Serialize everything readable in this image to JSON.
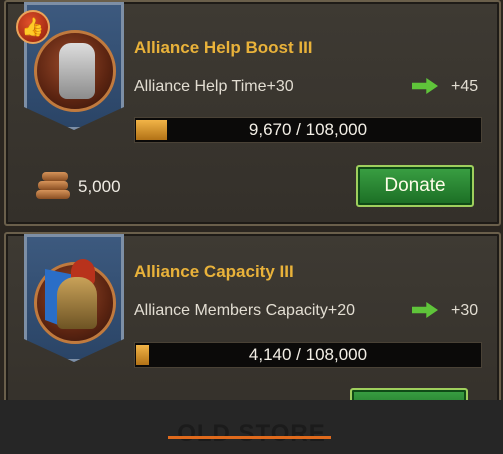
{
  "cards": [
    {
      "title": "Alliance Help Boost III",
      "description": "Alliance Help Time+30",
      "increase": "+45",
      "progress_text": "9,670 / 108,000",
      "progress_fraction": 0.0895,
      "cost_value": "5,000",
      "donate_label": "Donate",
      "icon": "knight-armor-icon",
      "badge_icon": "thumbs-up-icon"
    },
    {
      "title": "Alliance Capacity III",
      "description": "Alliance Members Capacity+20",
      "increase": "+30",
      "progress_text": "4,140 / 108,000",
      "progress_fraction": 0.0383,
      "icon": "spartan-helmet-icon"
    }
  ],
  "overlay": {
    "text": "OLD STORE"
  },
  "colors": {
    "accent_title": "#e9b23a",
    "progress_fill": "#f2b447",
    "donate_green": "#2b8a33",
    "arrow_green": "#5fc43a"
  }
}
